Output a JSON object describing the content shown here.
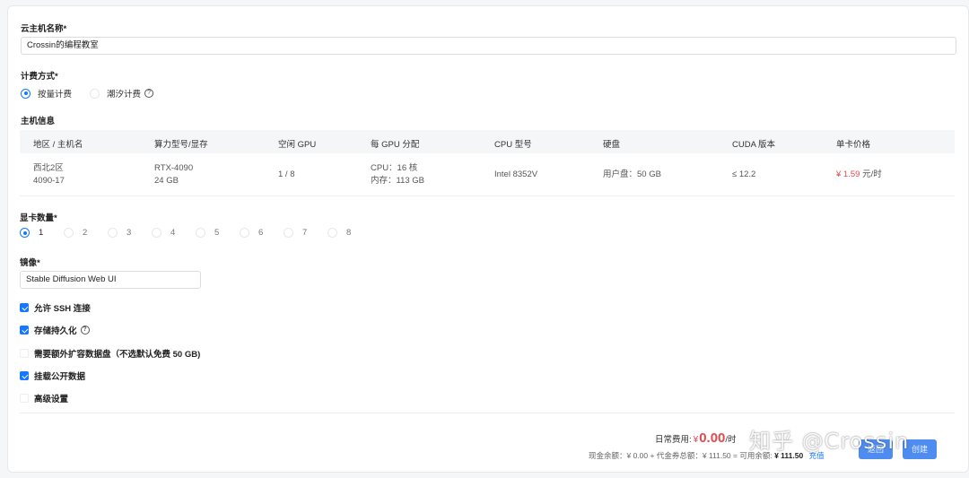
{
  "form": {
    "name_label": "云主机名称*",
    "name_value": "Crossin的编程教室",
    "billing_label": "计费方式*",
    "billing_options": [
      "按量计费",
      "潮汐计费"
    ],
    "host_info_label": "主机信息",
    "gpu_count_label": "显卡数量*",
    "gpu_count_options": [
      "1",
      "2",
      "3",
      "4",
      "5",
      "6",
      "7",
      "8"
    ],
    "image_label": "镜像*",
    "image_value": "Stable Diffusion Web UI",
    "checkboxes": [
      {
        "label": "允许 SSH 连接",
        "checked": true
      },
      {
        "label": "存储持久化",
        "checked": true
      },
      {
        "label": "需要额外扩容数据盘（不选默认免费 50 GB)",
        "checked": false
      },
      {
        "label": "挂载公开数据",
        "checked": true
      },
      {
        "label": "高级设置",
        "checked": false
      }
    ]
  },
  "table": {
    "headers": [
      "地区 / 主机名",
      "算力型号/显存",
      "空闲 GPU",
      "每 GPU 分配",
      "CPU 型号",
      "硬盘",
      "CUDA 版本",
      "单卡价格"
    ],
    "row": {
      "region": "西北2区",
      "host": "4090-17",
      "model": "RTX-4090",
      "vram": "24 GB",
      "free_gpu": "1 / 8",
      "cpu_alloc": "CPU：16 核",
      "mem_alloc": "内存：113 GB",
      "cpu_model": "Intel 8352V",
      "disk": "用户盘：50 GB",
      "cuda": "≤ 12.2",
      "price": "¥ 1.59",
      "price_unit": "元/时"
    }
  },
  "footer": {
    "fee_label": "日常费用:",
    "fee_symbol": "¥",
    "fee_value": "0.00",
    "fee_unit": "/时",
    "balance_text": "现金余额：¥ 0.00 + 代金券总额：¥ 111.50 = 可用余额:",
    "available": "¥ 111.50",
    "recharge": "充值",
    "cancel_button": "返回",
    "create_button": "创建"
  },
  "watermark": "知乎 @Crossin",
  "colors": {
    "accent": "#1677ff",
    "price": "#e5484d"
  }
}
